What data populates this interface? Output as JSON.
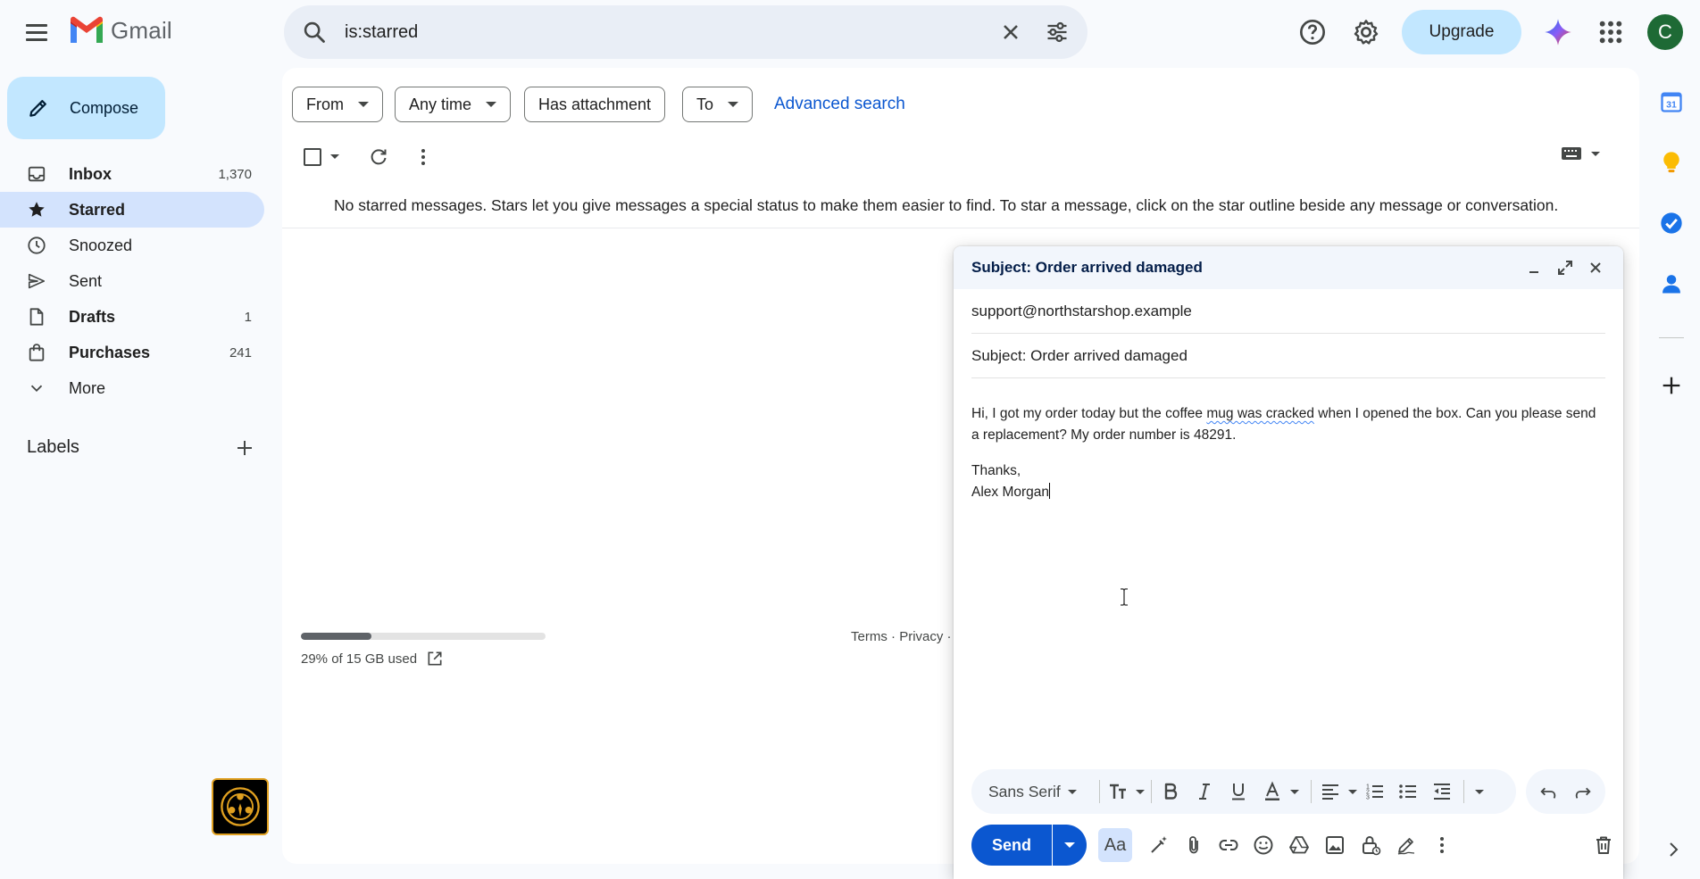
{
  "app": {
    "name": "Gmail"
  },
  "search": {
    "query": "is:starred"
  },
  "header": {
    "upgrade_label": "Upgrade",
    "avatar_letter": "C"
  },
  "compose_button": {
    "label": "Compose"
  },
  "nav": {
    "items": [
      {
        "label": "Inbox",
        "count": "1,370",
        "bold": true
      },
      {
        "label": "Starred",
        "count": "",
        "bold": true,
        "active": true
      },
      {
        "label": "Snoozed",
        "count": "",
        "bold": false
      },
      {
        "label": "Sent",
        "count": "",
        "bold": false
      },
      {
        "label": "Drafts",
        "count": "1",
        "bold": true
      },
      {
        "label": "Purchases",
        "count": "241",
        "bold": true
      },
      {
        "label": "More",
        "count": "",
        "bold": false
      }
    ],
    "labels_heading": "Labels"
  },
  "filters": {
    "from": "From",
    "any_time": "Any time",
    "has_attachment": "Has attachment",
    "to": "To",
    "advanced_search": "Advanced search"
  },
  "main": {
    "empty_message": "No starred messages. Stars let you give messages a special status to make them easier to find. To star a message, click on the star outline beside any message or conversation.",
    "storage_text": "29% of 15 GB used",
    "storage_fraction": 0.29,
    "footer": {
      "terms": "Terms",
      "privacy": "Privacy",
      "sep": " · "
    }
  },
  "compose": {
    "title": "Subject: Order arrived damaged",
    "to": "support@northstarshop.example",
    "subject": "Subject: Order arrived damaged",
    "body_line1_a": "Hi, I got my order today but the coffee ",
    "body_line1_misspelled": "mug was cracked",
    "body_line1_b": " when I opened the box. Can you please send a replacement? My order number is 48291.",
    "body_signoff": "Thanks,",
    "body_name": "Alex Morgan",
    "font": "Sans Serif",
    "send_label": "Send",
    "aa_label": "Aa"
  },
  "colors": {
    "accent": "#0b57d0",
    "nav_active": "#d3e3fd",
    "compose_button": "#c2e7ff",
    "avatar": "#1e6a35"
  }
}
